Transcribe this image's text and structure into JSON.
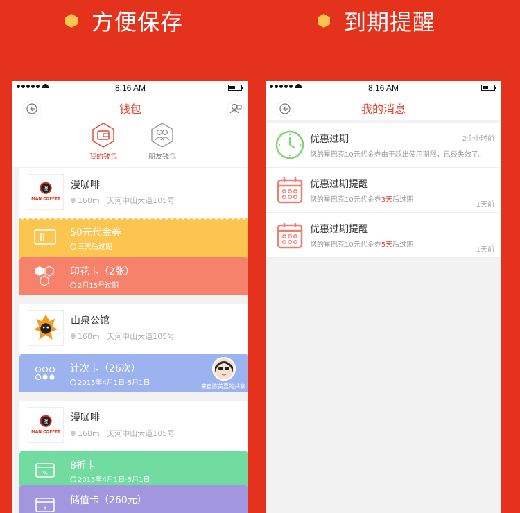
{
  "banner": {
    "left_title": "方便保存",
    "right_title": "到期提醒",
    "bullet_color": "#fbc54f"
  },
  "status_bar": {
    "time": "8:16 AM"
  },
  "wallet": {
    "title": "钱包",
    "tabs": [
      {
        "label": "我的钱包",
        "icon": "wallet-icon",
        "active": true
      },
      {
        "label": "朋友钱包",
        "icon": "friends-icon",
        "active": false
      }
    ],
    "merchants": [
      {
        "name": "漫咖啡",
        "logo": "man-coffee-logo",
        "distance": "168m",
        "address": "天河中山大道105号",
        "cards": [
          {
            "type": "coupon",
            "name": "50元代金券",
            "expiry": "三天后过期",
            "color": "#fbc54f",
            "icon": "ticket-icon"
          },
          {
            "type": "stamp",
            "name": "印花卡（2张）",
            "expiry": "2月15号过期",
            "color": "#f7826c",
            "icon": "hexagons-icon"
          }
        ]
      },
      {
        "name": "山泉公馆",
        "logo": "shanquan-logo",
        "distance": "168m",
        "address": "天河中山大道105号",
        "cards": [
          {
            "type": "count",
            "name": "计次卡（26次）",
            "expiry": "2015年4月1日-5月1日",
            "color": "#9cb3ef",
            "icon": "dots-icon",
            "shared_from": "来自陈美嘉的共享"
          }
        ]
      },
      {
        "name": "漫咖啡",
        "logo": "man-coffee-logo",
        "distance": "168m",
        "address": "天河中山大道105号",
        "cards": [
          {
            "type": "discount",
            "name": "8折卡",
            "expiry": "2015年4月1日-5月1日",
            "color": "#72dca0",
            "icon": "percent-card-icon"
          },
          {
            "type": "stored",
            "name": "储值卡（260元）",
            "expiry": "",
            "color": "#a297df",
            "icon": "yen-card-icon"
          }
        ]
      }
    ]
  },
  "messages": {
    "title": "我的消息",
    "items": [
      {
        "icon": "clock-icon",
        "title": "优惠过期",
        "body": "您的星巴克10元代金券由于超出使用期限，已经失效了。",
        "time": "2个小时前"
      },
      {
        "icon": "calendar-icon",
        "title": "优惠过期提醒",
        "body_prefix": "您的星巴克10元代金券",
        "body_highlight": "3天",
        "body_suffix": "后过期",
        "time": "1天前"
      },
      {
        "icon": "calendar-icon",
        "title": "优惠过期提醒",
        "body_prefix": "您的星巴克10元代金券",
        "body_highlight": "5天",
        "body_suffix": "后过期",
        "time": "1天前"
      }
    ]
  }
}
